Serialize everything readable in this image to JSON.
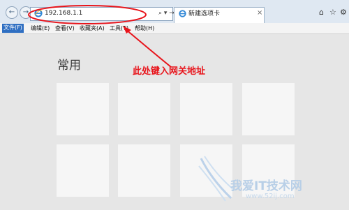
{
  "browser": {
    "address": "192.168.1.1",
    "address_tools": "⌕ ▾ →",
    "tab_title": "新建选项卡",
    "tab_close": "×",
    "back_icon": "←",
    "forward_icon": "→",
    "window_controls": [
      "⌂",
      "☆",
      "⚙"
    ]
  },
  "menu": {
    "items": [
      "文件(F)",
      "编辑(E)",
      "查看(V)",
      "收藏夹(A)",
      "工具(T)",
      "帮助(H)"
    ]
  },
  "content": {
    "heading": "常用"
  },
  "annotation": {
    "text": "此处键入网关地址",
    "color": "#e8141b"
  },
  "watermark": {
    "text": "我爱IT技术网",
    "url": "www.52ij.com"
  }
}
